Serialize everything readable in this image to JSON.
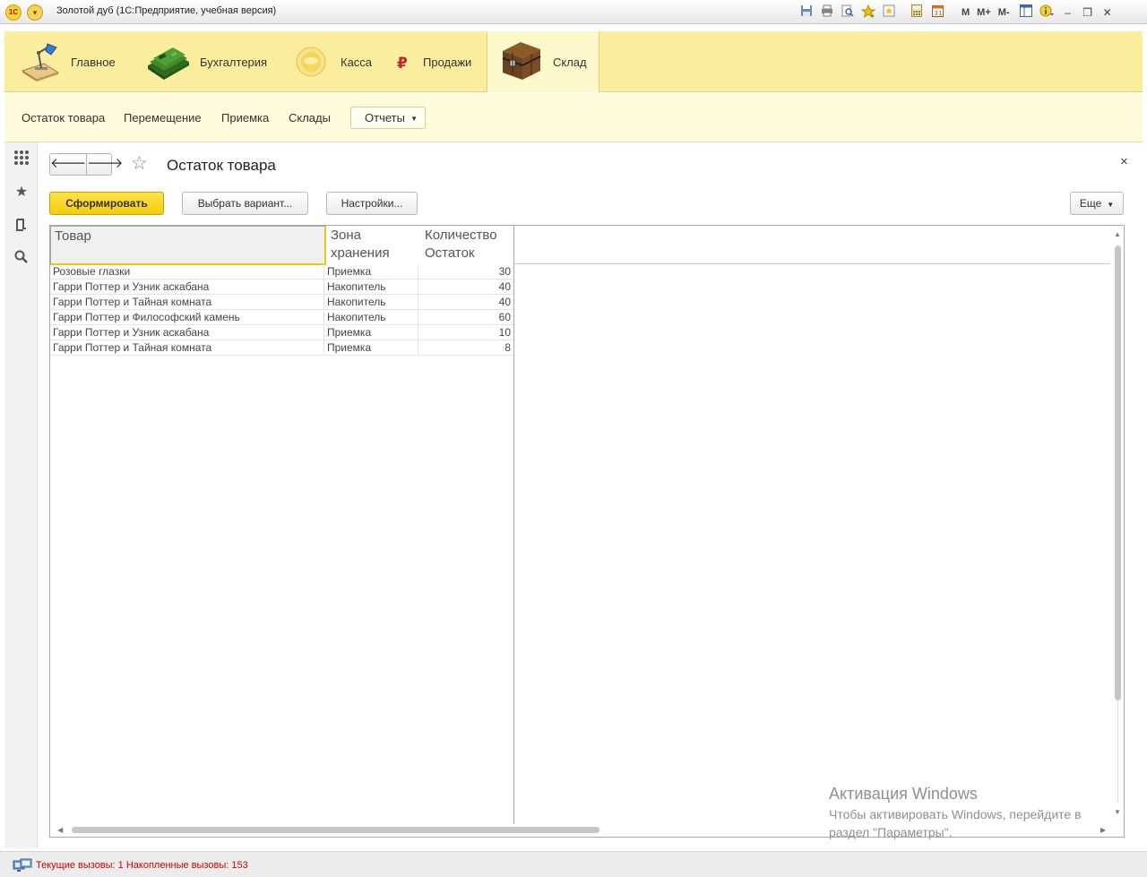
{
  "window": {
    "title": "Золотой дуб  (1С:Предприятие, учебная версия)",
    "toolbar_labels": {
      "m": "M",
      "m_plus": "M+",
      "m_minus": "M-"
    }
  },
  "sections": [
    {
      "label": "Главное"
    },
    {
      "label": "Бухгалтерия"
    },
    {
      "label": "Касса"
    },
    {
      "label": "Продажи"
    },
    {
      "label": "Склад"
    }
  ],
  "commands": {
    "items": [
      "Остаток товара",
      "Перемещение",
      "Приемка",
      "Склады"
    ],
    "reports_label": "Отчеты"
  },
  "page": {
    "title": "Остаток товара",
    "close_label": "×"
  },
  "buttons": {
    "generate": "Сформировать",
    "choose_variant": "Выбрать вариант...",
    "settings": "Настройки...",
    "more": "Еще"
  },
  "report": {
    "columns": [
      {
        "line1": "Товар",
        "line2": ""
      },
      {
        "line1": "Зона",
        "line2": "хранения"
      },
      {
        "line1": "Количество",
        "line2": "Остаток"
      }
    ],
    "rows": [
      {
        "product": "Розовые глазки",
        "zone": "Приемка",
        "qty": "30"
      },
      {
        "product": "Гарри Поттер и Узник аскабана",
        "zone": "Накопитель",
        "qty": "40"
      },
      {
        "product": "Гарри Поттер и Тайная комната",
        "zone": "Накопитель",
        "qty": "40"
      },
      {
        "product": "Гарри Поттер и Философский камень",
        "zone": "Накопитель",
        "qty": "60"
      },
      {
        "product": "Гарри Поттер и Узник аскабана",
        "zone": "Приемка",
        "qty": "10"
      },
      {
        "product": "Гарри Поттер и Тайная комната",
        "zone": "Приемка",
        "qty": "8"
      }
    ]
  },
  "watermark": {
    "line1": "Активация Windows",
    "line2": "Чтобы активировать Windows, перейдите в",
    "line3": "раздел \"Параметры\"."
  },
  "status": {
    "text": "Текущие вызовы: 1   Накопленные вызовы: 153"
  },
  "colors": {
    "section_bar": "#fbed9e",
    "command_bar": "#fefadc",
    "primary_button": "#f4cd0a",
    "status_text": "#d40000"
  }
}
